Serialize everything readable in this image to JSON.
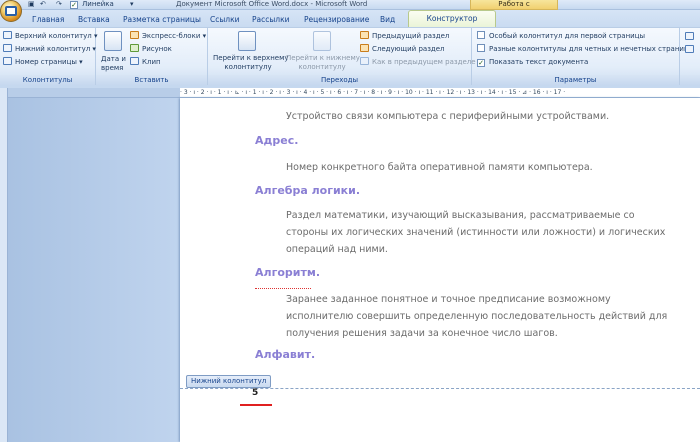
{
  "qat": {
    "ruler_label": "Линейка"
  },
  "window": {
    "title": "Документ Microsoft Office Word.docx - Microsoft Word",
    "context_title": "Работа с колонтитулами"
  },
  "tabs": [
    "Главная",
    "Вставка",
    "Разметка страницы",
    "Ссылки",
    "Рассылки",
    "Рецензирование",
    "Вид"
  ],
  "active_tab": "Конструктор",
  "ribbon": {
    "kolontituly": {
      "label": "Колонтитулы",
      "items": [
        "Верхний колонтитул",
        "Нижний колонтитул",
        "Номер страницы"
      ]
    },
    "vstavka": {
      "label": "Вставить",
      "date_time_1": "Дата и",
      "date_time_2": "время",
      "items": [
        "Экспресс-блоки",
        "Рисунок",
        "Клип"
      ]
    },
    "perekhody": {
      "label": "Переходы",
      "go_header_1": "Перейти к верхнему",
      "go_header_2": "колонтитулу",
      "go_footer_1": "Перейти к нижнему",
      "go_footer_2": "колонтитулу",
      "items": [
        "Предыдущий раздел",
        "Следующий раздел",
        "Как в предыдущем разделе"
      ]
    },
    "parametry": {
      "label": "Параметры",
      "items": [
        "Особый колонтитул для первой страницы",
        "Разные колонтитулы для четных и нечетных страниц",
        "Показать текст документа"
      ],
      "checked": [
        false,
        false,
        true
      ]
    }
  },
  "ruler": {
    "marks": "· 3 · ı · 2 · ı · 1 · ı · ⊾ · ı · 1 · ı · 2 · ı · 3 · ı · 4 · ı · 5 · ı · 6 · ı · 7 · ı · 8 · ı · 9 · ı · 10 · ı · 11 · ı · 12 · ı · 13 · ı · 14 · ı · 15 · ⊿ · 16 · ı · 17 ·"
  },
  "document": {
    "entries": [
      {
        "def": "Устройство связи компьютера с периферийными устройствами."
      },
      {
        "term": "Адрес.",
        "def": "Номер конкретного байта оперативной памяти компьютера."
      },
      {
        "term": "Алгебра логики.",
        "def": "Раздел математики, изучающий высказывания, рассматриваемые со стороны их логических значений (истинности или ложности) и логических операций над ними."
      },
      {
        "term": "Алгоритм.",
        "def": "Заранее заданное понятное и точное предписание возможному исполнителю совершить определенную последовательность действий для получения решения задачи за конечное число шагов."
      },
      {
        "term": "Алфавит."
      }
    ],
    "footer_label": "Нижний колонтитул",
    "page_number": "5"
  }
}
